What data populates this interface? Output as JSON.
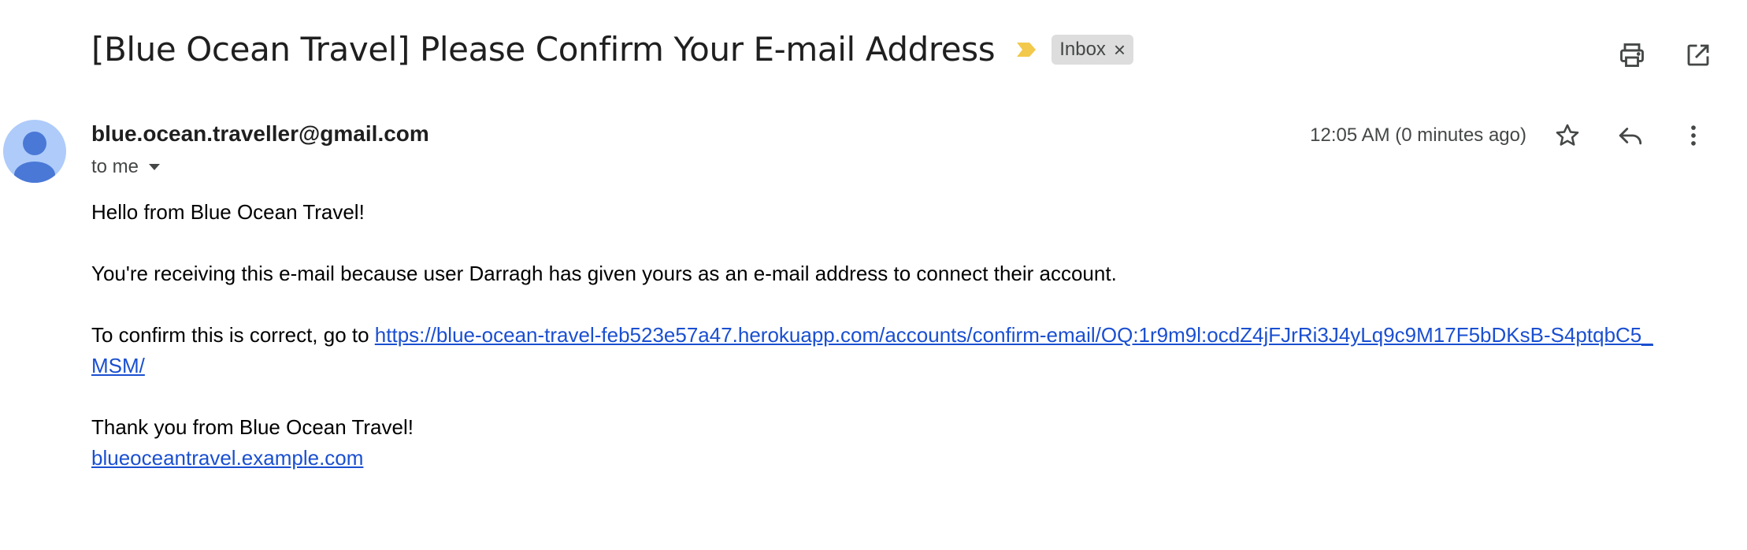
{
  "email": {
    "subject": "[Blue Ocean Travel] Please Confirm Your E-mail Address",
    "label": "Inbox",
    "label_close": "×",
    "sender": "blue.ocean.traveller@gmail.com",
    "recipient": "to me",
    "time": "12:05 AM (0 minutes ago)",
    "body": {
      "greeting": "Hello from Blue Ocean Travel!",
      "reason": "You're receiving this e-mail because user Darragh has given yours as an e-mail address to connect their account.",
      "confirm_prefix": "To confirm this is correct, go to ",
      "confirm_link": "https://blue-ocean-travel-feb523e57a47.herokuapp.com/accounts/confirm-email/OQ:1r9m9l:ocdZ4jFJrRi3J4yLq9c9M17F5bDKsB-S4ptqbC5_MSM/",
      "thanks": "Thank you from Blue Ocean Travel!",
      "site_link": "blueoceantravel.example.com"
    }
  },
  "icons": {
    "importance": "importance-marker-icon",
    "print": "print-icon",
    "open_new_window": "open-in-new-window-icon",
    "star": "star-icon",
    "reply": "reply-icon",
    "more": "more-vert-icon",
    "avatar": "person-avatar-icon",
    "dropdown": "dropdown-arrow-icon"
  },
  "colors": {
    "link": "#1a4fd0",
    "importance": "#f2c94c",
    "avatar_bg": "#aecbfa",
    "avatar_fg": "#4a78d6",
    "chip_bg": "#dddddd"
  }
}
